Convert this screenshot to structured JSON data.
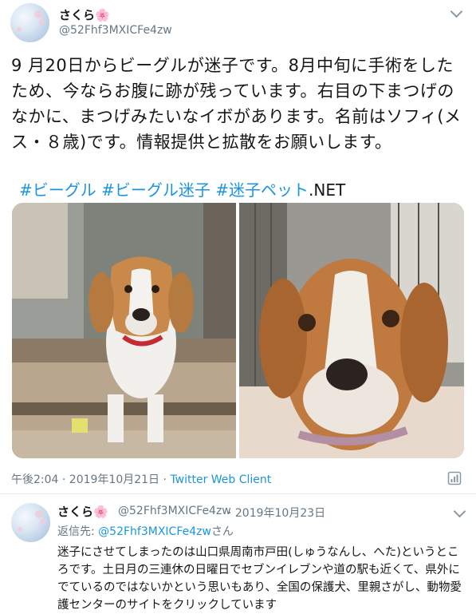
{
  "tweet": {
    "author_name": "さくら🌸",
    "author_handle": "@52Fhf3MXICFe4zw",
    "text": "9 月20日からビーグルが迷子です。8月中旬に手術をしたため、今ならお腹に跡が残っています。右目の下まつげのなかに、まつげみたいなイボがあります。名前はソフィ(メス・８歳)です。情報提供と拡散をお願いします。",
    "hashtags": [
      "#ビーグル",
      "#ビーグル迷子",
      "#迷子ペット"
    ],
    "hashtag_suffix": ".NET",
    "timestamp": "午後2:04 · 2019年10月21日 · ",
    "client": "Twitter Web Client"
  },
  "reply": {
    "author_name": "さくら🌸",
    "author_handle": "@52Fhf3MXICFe4zw",
    "date": "· 2019年10月23日",
    "replying_label": "返信先: ",
    "replying_mention": "@52Fhf3MXICFe4zw",
    "replying_suffix": "さん",
    "text": "迷子にさせてしまったのは山口県周南市戸田(しゅうなんし、へた)というところです。土日月の三連休の日曜日でセブンイレブンや道の駅も近くて、県外にでているのではないかという思いもあり、全国の保護犬、里親さがし、動物愛護センターのサイトをクリックしています"
  },
  "icons": {
    "menu": "chevron-down-icon",
    "analytics": "analytics-icon"
  },
  "colors": {
    "link": "#1b95e0",
    "secondary_text": "#657786",
    "divider": "#e6ecf0"
  }
}
